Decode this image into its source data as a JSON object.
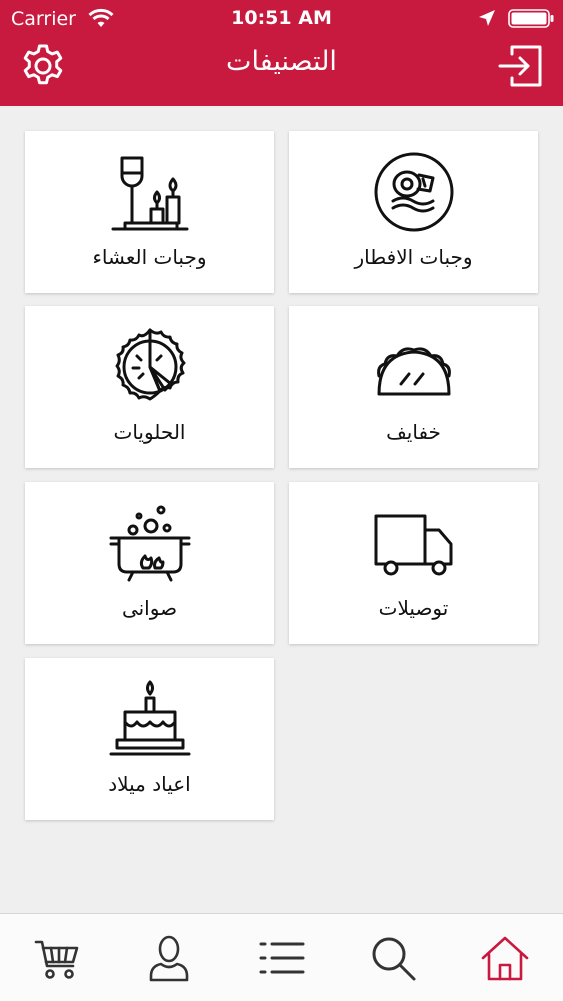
{
  "status_bar": {
    "carrier": "Carrier",
    "time": "10:51 AM"
  },
  "header": {
    "title": "التصنيفات",
    "background": "#c8193e"
  },
  "categories": [
    {
      "label": "وجبات الافطار",
      "icon": "breakfast-plate-icon"
    },
    {
      "label": "وجبات العشاء",
      "icon": "dinner-candles-icon"
    },
    {
      "label": "خفايف",
      "icon": "taco-icon"
    },
    {
      "label": "الحلويات",
      "icon": "pie-icon"
    },
    {
      "label": "توصيلات",
      "icon": "delivery-truck-icon"
    },
    {
      "label": "صوانى",
      "icon": "cooking-pot-icon"
    },
    {
      "label": "اعياد ميلاد",
      "icon": "birthday-cake-icon"
    }
  ],
  "tabbar": {
    "items": [
      "cart-icon",
      "profile-icon",
      "list-icon",
      "search-icon",
      "home-icon"
    ],
    "active": "home-icon",
    "active_color": "#c8193e",
    "inactive_color": "#333333"
  }
}
